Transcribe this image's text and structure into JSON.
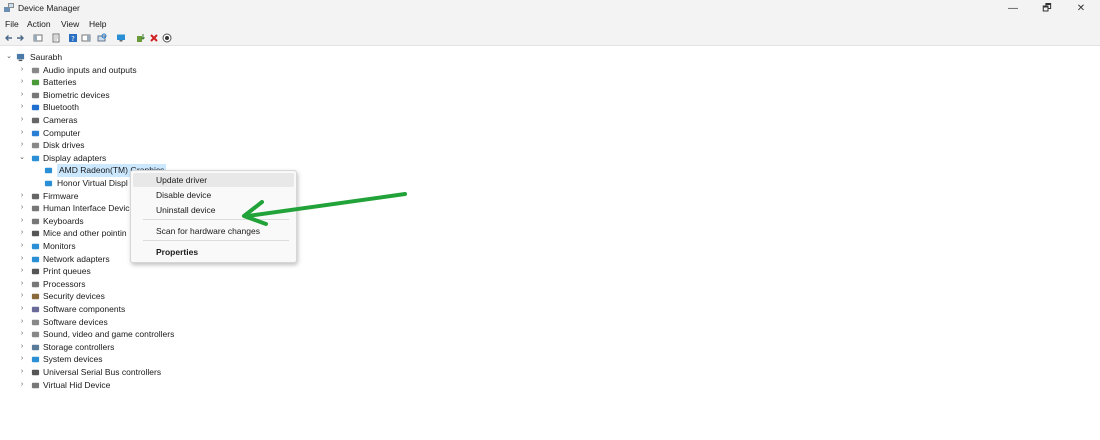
{
  "window": {
    "title": "Device Manager",
    "minimize": "—",
    "maximize": "🗗",
    "close": "✕"
  },
  "menu": [
    "File",
    "Action",
    "View",
    "Help"
  ],
  "toolbar_icons": [
    "back-icon",
    "forward-icon",
    "show-hide-tree-icon",
    "properties-icon",
    "help-icon",
    "action-pane-icon",
    "scan-icon",
    "monitor-icon",
    "update-driver-icon",
    "uninstall-icon",
    "enable-device-icon"
  ],
  "tree": {
    "root": "Saurabh",
    "categories": [
      {
        "label": "Audio inputs and outputs",
        "icon": "speaker-icon",
        "color": "#888"
      },
      {
        "label": "Batteries",
        "icon": "battery-icon",
        "color": "#4a9a3a"
      },
      {
        "label": "Biometric devices",
        "icon": "biometric-icon",
        "color": "#777"
      },
      {
        "label": "Bluetooth",
        "icon": "bluetooth-icon",
        "color": "#1e6fd0"
      },
      {
        "label": "Cameras",
        "icon": "camera-icon",
        "color": "#666"
      },
      {
        "label": "Computer",
        "icon": "computer-icon",
        "color": "#2a7fd4"
      },
      {
        "label": "Disk drives",
        "icon": "disk-icon",
        "color": "#888"
      },
      {
        "label": "Display adapters",
        "icon": "display-adapter-icon",
        "color": "#2a8fd4",
        "expanded": true,
        "children": [
          {
            "label": "AMD Radeon(TM) Graphics",
            "icon": "display-adapter-icon",
            "selected": true
          },
          {
            "label": "Honor Virtual Displ",
            "icon": "display-adapter-icon"
          }
        ]
      },
      {
        "label": "Firmware",
        "icon": "firmware-icon",
        "color": "#666"
      },
      {
        "label": "Human Interface Devic",
        "icon": "hid-icon",
        "color": "#777"
      },
      {
        "label": "Keyboards",
        "icon": "keyboard-icon",
        "color": "#777"
      },
      {
        "label": "Mice and other pointin",
        "icon": "mouse-icon",
        "color": "#555"
      },
      {
        "label": "Monitors",
        "icon": "monitor-icon",
        "color": "#2a8fd4"
      },
      {
        "label": "Network adapters",
        "icon": "network-icon",
        "color": "#2a8fd4"
      },
      {
        "label": "Print queues",
        "icon": "printer-icon",
        "color": "#555"
      },
      {
        "label": "Processors",
        "icon": "processor-icon",
        "color": "#777"
      },
      {
        "label": "Security devices",
        "icon": "security-icon",
        "color": "#8a6a3a"
      },
      {
        "label": "Software components",
        "icon": "software-component-icon",
        "color": "#6a6a9a"
      },
      {
        "label": "Software devices",
        "icon": "software-device-icon",
        "color": "#888"
      },
      {
        "label": "Sound, video and game controllers",
        "icon": "sound-icon",
        "color": "#888"
      },
      {
        "label": "Storage controllers",
        "icon": "storage-icon",
        "color": "#5a7a9a"
      },
      {
        "label": "System devices",
        "icon": "system-device-icon",
        "color": "#2a8fd4"
      },
      {
        "label": "Universal Serial Bus controllers",
        "icon": "usb-icon",
        "color": "#555"
      },
      {
        "label": "Virtual Hid Device",
        "icon": "hid-icon",
        "color": "#777"
      }
    ]
  },
  "context_menu": {
    "update": "Update driver",
    "disable": "Disable device",
    "uninstall": "Uninstall device",
    "scan": "Scan for hardware changes",
    "properties": "Properties"
  },
  "colors": {
    "selection": "#cce8ff",
    "annotation_arrow": "#22a33a",
    "chrome": "#f3f3f3"
  }
}
